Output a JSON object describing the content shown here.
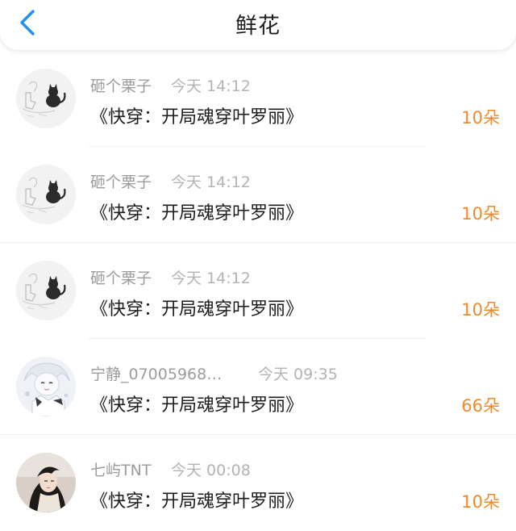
{
  "header": {
    "title": "鲜花",
    "back_icon": "chevron-left-icon",
    "accent": "#1f8ff0"
  },
  "flower_color": "#ef8a2c",
  "records": [
    {
      "user": "砸个栗子",
      "time": "今天 14:12",
      "book": "《快穿：开局魂穿叶罗丽》",
      "count": "10朵",
      "avatar": "cat-sketch-avatar"
    },
    {
      "user": "砸个栗子",
      "time": "今天 14:12",
      "book": "《快穿：开局魂穿叶罗丽》",
      "count": "10朵",
      "avatar": "cat-sketch-avatar"
    },
    {
      "user": "砸个栗子",
      "time": "今天 14:12",
      "book": "《快穿：开局魂穿叶罗丽》",
      "count": "10朵",
      "avatar": "cat-sketch-avatar"
    },
    {
      "user": "宁静_07005968…",
      "time": "今天 09:35",
      "book": "《快穿：开局魂穿叶罗丽》",
      "count": "66朵",
      "avatar": "anime-girl-avatar"
    },
    {
      "user": "七屿TNT",
      "time": "今天 00:08",
      "book": "《快穿：开局魂穿叶罗丽》",
      "count": "10朵",
      "avatar": "photo-portrait-avatar"
    }
  ]
}
